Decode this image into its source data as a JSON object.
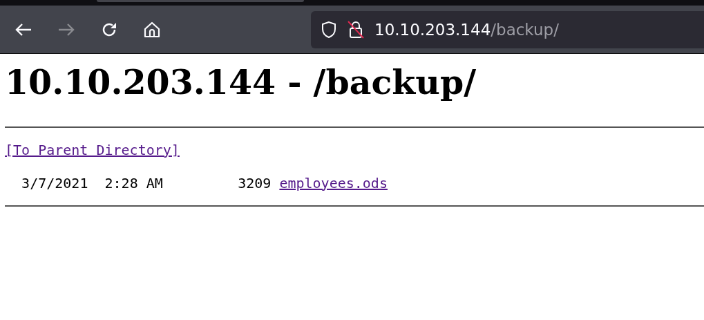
{
  "browser": {
    "address_host": "10.10.203.144",
    "address_path": "/backup/",
    "forward_disabled": true
  },
  "page": {
    "heading": "10.10.203.144 - /backup/",
    "parent_link": "[To Parent Directory]",
    "entries": [
      {
        "date": "3/7/2021",
        "time": "2:28 AM",
        "size": "3209",
        "name": "employees.ods"
      }
    ]
  }
}
